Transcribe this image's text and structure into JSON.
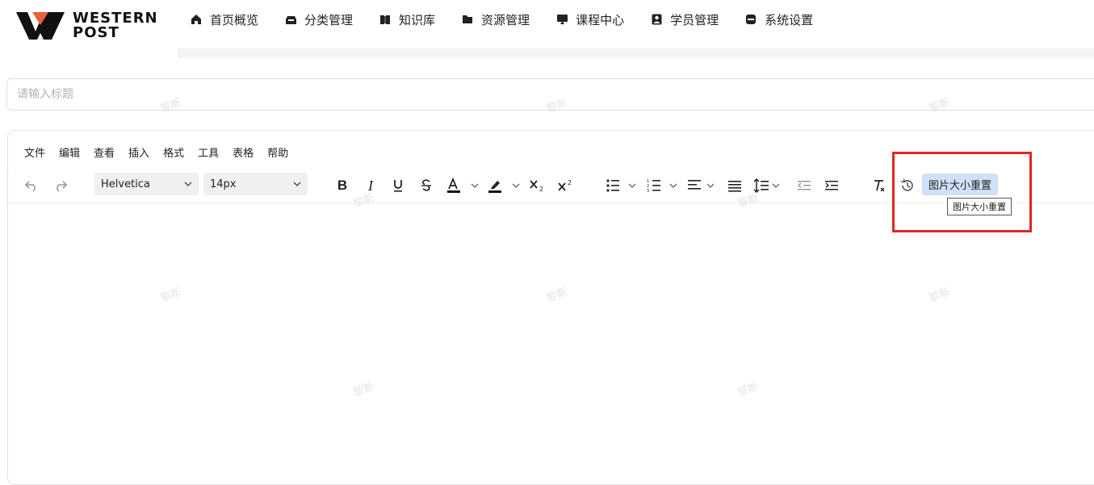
{
  "logo": {
    "line1": "WESTERN",
    "line2": "POST"
  },
  "nav": [
    {
      "label": "首页概览",
      "icon": "home-icon"
    },
    {
      "label": "分类管理",
      "icon": "inbox-icon"
    },
    {
      "label": "知识库",
      "icon": "book-icon"
    },
    {
      "label": "资源管理",
      "icon": "folder-icon"
    },
    {
      "label": "课程中心",
      "icon": "monitor-icon"
    },
    {
      "label": "学员管理",
      "icon": "user-badge-icon"
    },
    {
      "label": "系统设置",
      "icon": "settings-icon"
    }
  ],
  "title": {
    "placeholder": "请输入标题",
    "value": ""
  },
  "editor": {
    "menu": [
      "文件",
      "编辑",
      "查看",
      "插入",
      "格式",
      "工具",
      "表格",
      "帮助"
    ],
    "font_family": "Helvetica",
    "font_size": "14px",
    "resize_button": "图片大小重置",
    "tooltip": "图片大小重置"
  },
  "watermark": "黎斯",
  "colors": {
    "accent_highlight": "#e32525",
    "button_bg": "#cfe0f7",
    "logo_orange": "#e8623c"
  }
}
